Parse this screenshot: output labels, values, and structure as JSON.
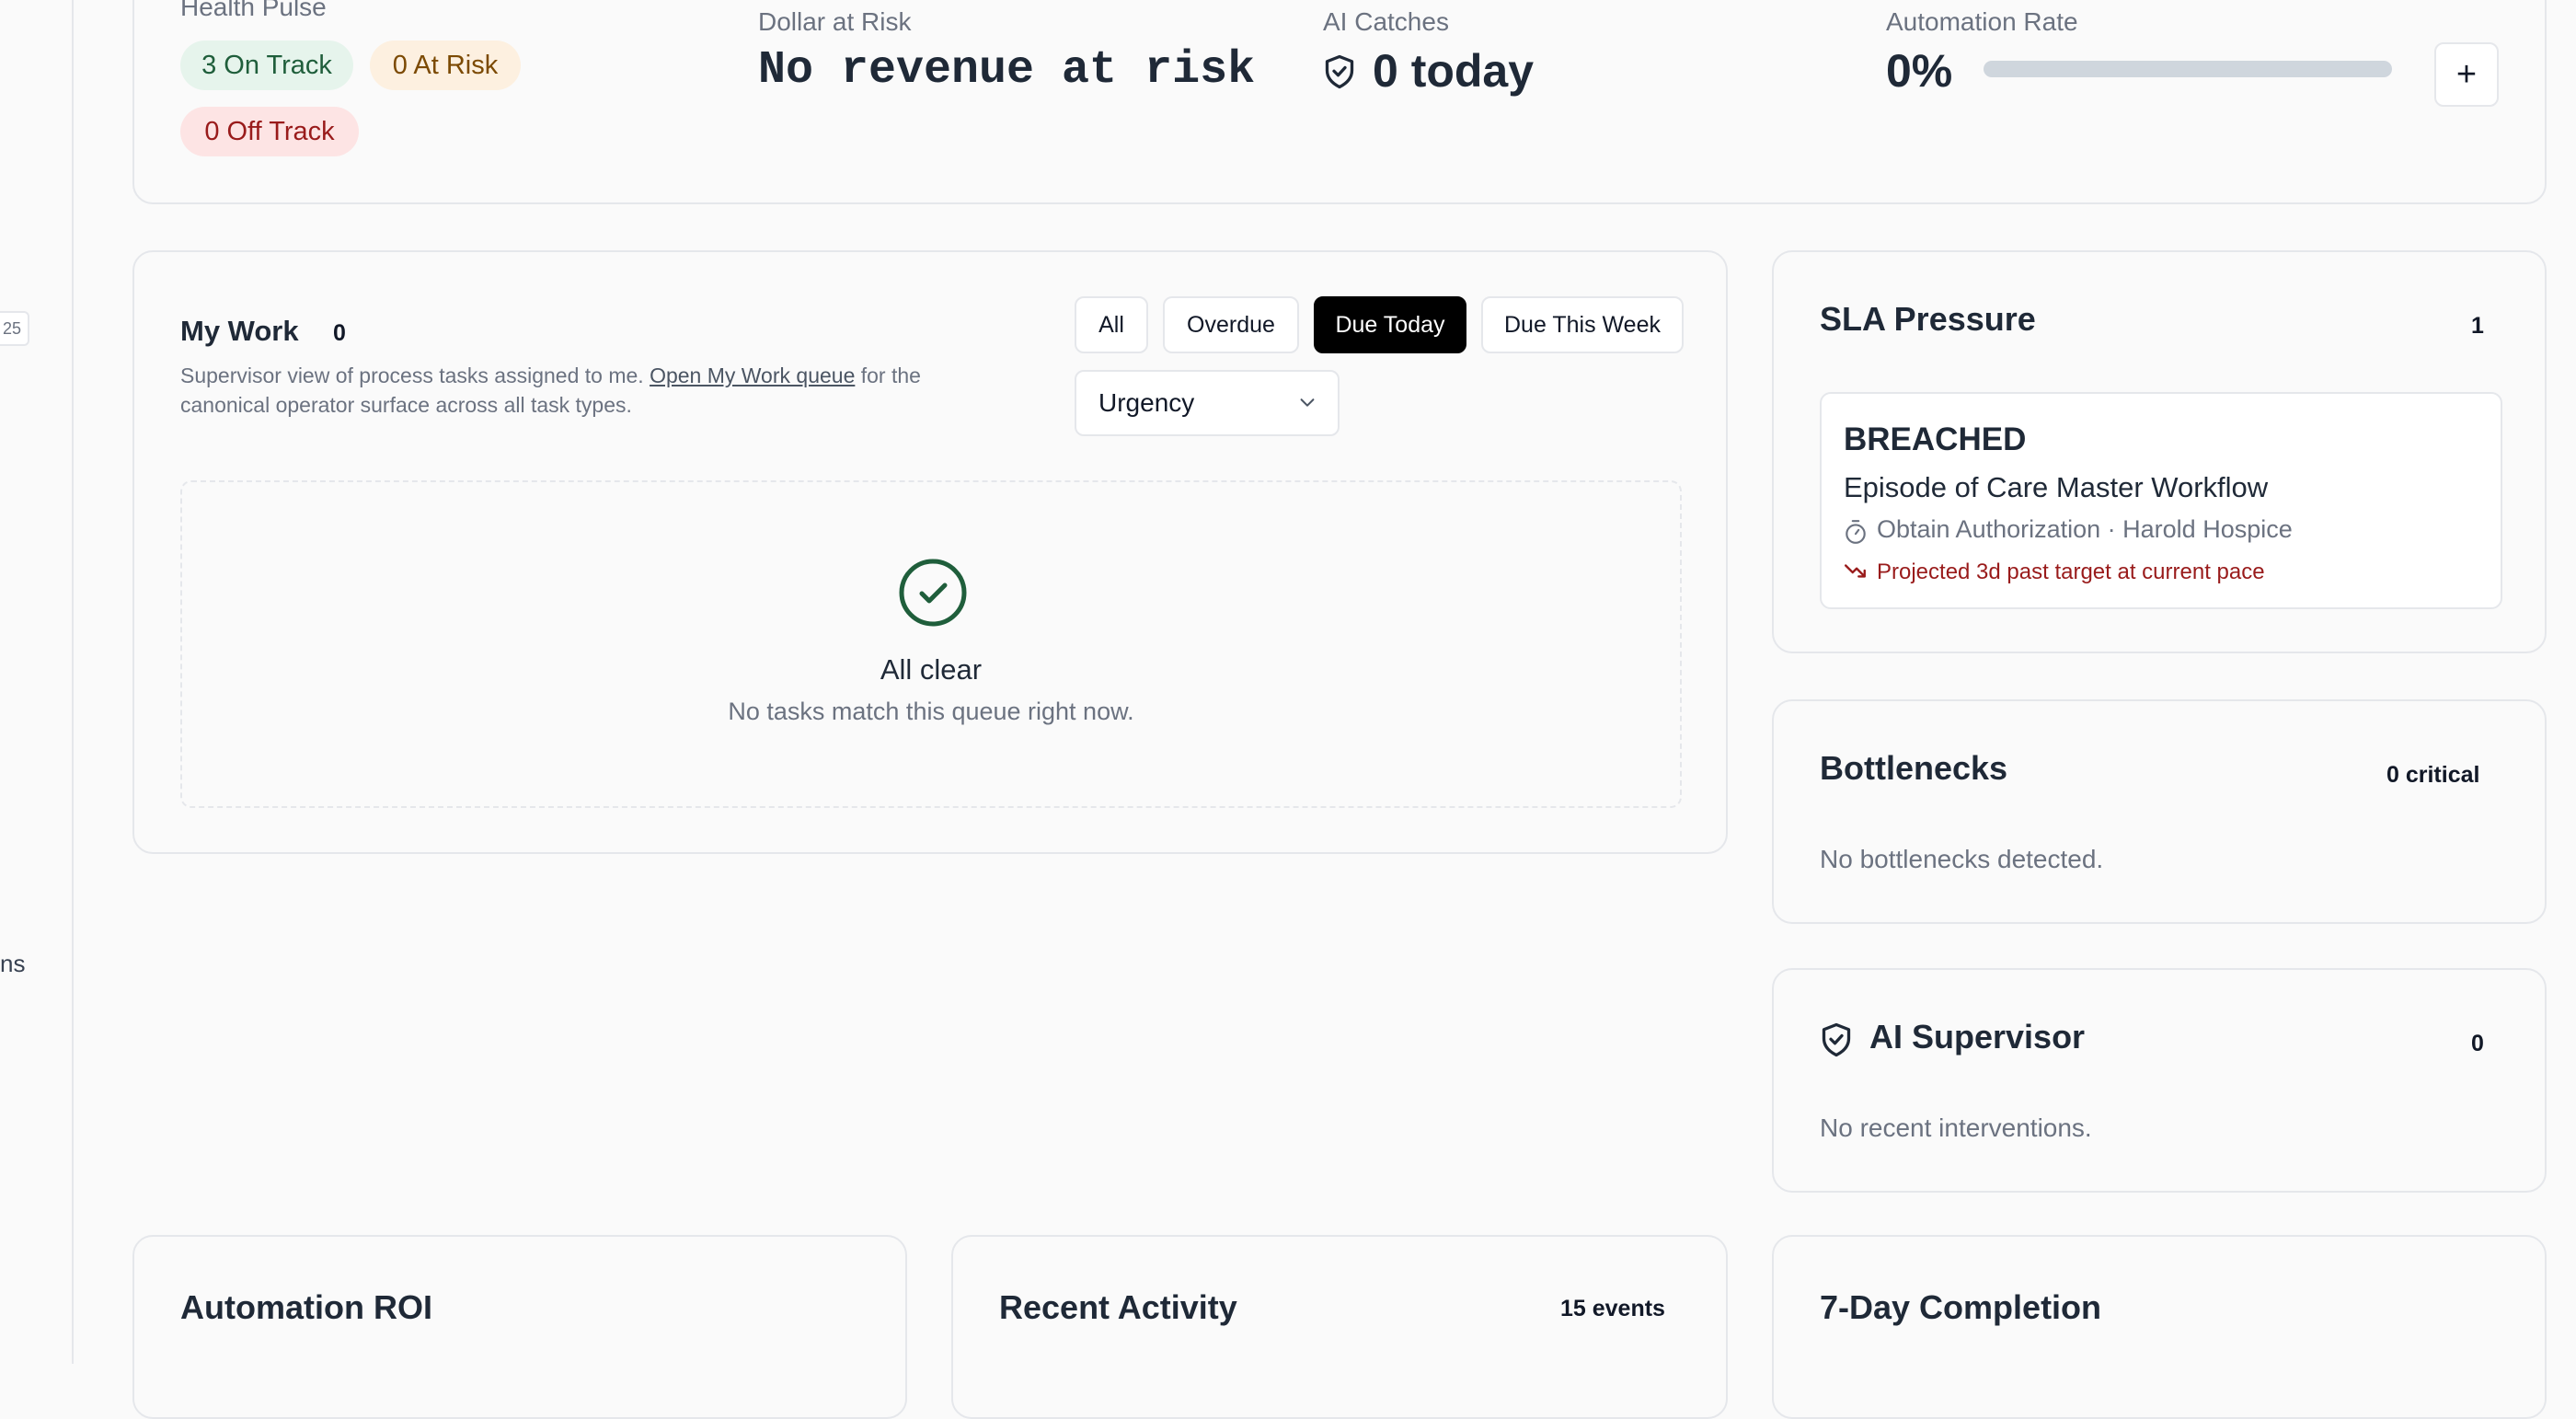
{
  "sidebar": {
    "badge": "25",
    "text": "ns"
  },
  "kpi": {
    "health_pulse": {
      "label": "Health Pulse",
      "on_track": "3 On Track",
      "at_risk": "0 At Risk",
      "off_track": "0 Off Track"
    },
    "dollar_at_risk": {
      "label": "Dollar at Risk",
      "value": "No revenue at risk"
    },
    "ai_catches": {
      "label": "AI Catches",
      "value": "0 today"
    },
    "automation_rate": {
      "label": "Automation Rate",
      "value": "0%",
      "progress": 0
    },
    "add_button": "+"
  },
  "my_work": {
    "title": "My Work",
    "count": "0",
    "desc_prefix": "Supervisor view of process tasks assigned to me.",
    "link": "Open My Work queue",
    "desc_suffix": "for the",
    "desc_line2": "canonical operator surface across all task types.",
    "filters": [
      "All",
      "Overdue",
      "Due Today",
      "Due This Week"
    ],
    "active_filter": "Due Today",
    "sort_value": "Urgency",
    "empty_title": "All clear",
    "empty_subtitle": "No tasks match this queue right now."
  },
  "sla": {
    "title": "SLA Pressure",
    "count": "1",
    "item": {
      "status": "BREACHED",
      "workflow": "Episode of Care Master Workflow",
      "detail": "Obtain Authorization · Harold Hospice",
      "projection": "Projected 3d past target at current pace"
    }
  },
  "bottlenecks": {
    "title": "Bottlenecks",
    "count": "0 critical",
    "empty": "No bottlenecks detected."
  },
  "ai_supervisor": {
    "title": "AI Supervisor",
    "count": "0",
    "empty": "No recent interventions."
  },
  "automation_roi": {
    "title": "Automation ROI"
  },
  "recent_activity": {
    "title": "Recent Activity",
    "count": "15 events"
  },
  "completion": {
    "title": "7-Day Completion"
  },
  "colors": {
    "on_track_bg": "#e6f4ec",
    "at_risk_bg": "#fdf0e0",
    "off_track_bg": "#fde4e4",
    "breach_red": "#991b1b",
    "success_green": "#1f5e3b"
  }
}
